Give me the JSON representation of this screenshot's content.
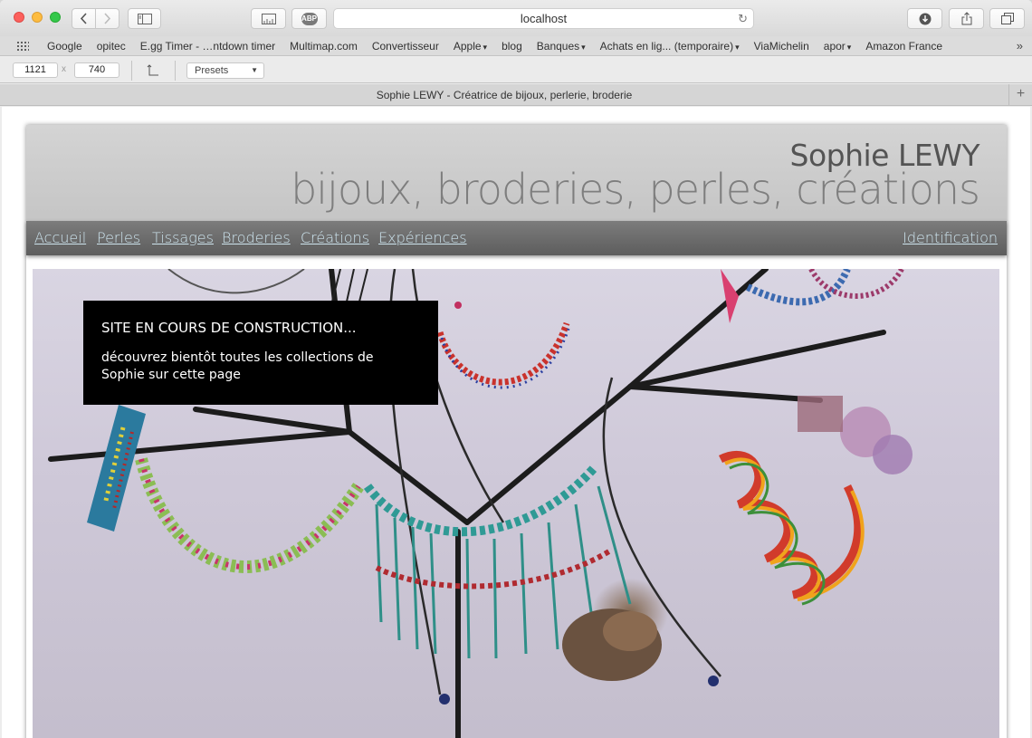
{
  "browser": {
    "address": "localhost",
    "tab_title": "Sophie LEWY - Créatrice de bijoux, perlerie, broderie",
    "abp_label": "ABP",
    "new_tab": "+"
  },
  "bookmarks": [
    {
      "label": "Google",
      "menu": false
    },
    {
      "label": "opitec",
      "menu": false
    },
    {
      "label": "E.gg Timer - …ntdown timer",
      "menu": false
    },
    {
      "label": "Multimap.com",
      "menu": false
    },
    {
      "label": "Convertisseur",
      "menu": false
    },
    {
      "label": "Apple",
      "menu": true
    },
    {
      "label": "blog",
      "menu": false
    },
    {
      "label": "Banques",
      "menu": true
    },
    {
      "label": "Achats en lig... (temporaire)",
      "menu": true
    },
    {
      "label": "ViaMichelin",
      "menu": false
    },
    {
      "label": "apor",
      "menu": true
    },
    {
      "label": "Amazon France",
      "menu": false
    }
  ],
  "responsive": {
    "width": "1121",
    "height": "740",
    "separator": "x",
    "presets": "Presets"
  },
  "site": {
    "name": "Sophie LEWY",
    "tagline": "bijoux, broderies, perles, créations",
    "nav": [
      "Accueil",
      "Perles",
      "Tissages",
      "Broderies",
      "Créations",
      "Expériences"
    ],
    "login": "Identification",
    "notice_title": "SITE EN COURS DE CONSTRUCTION...",
    "notice_text": "découvrez bientôt toutes les collections de Sophie sur cette page"
  },
  "colors": {
    "nav_link": "#cde4ee",
    "header_bg": "#c9c9c9",
    "nav_bg": "#6a6a6a"
  }
}
